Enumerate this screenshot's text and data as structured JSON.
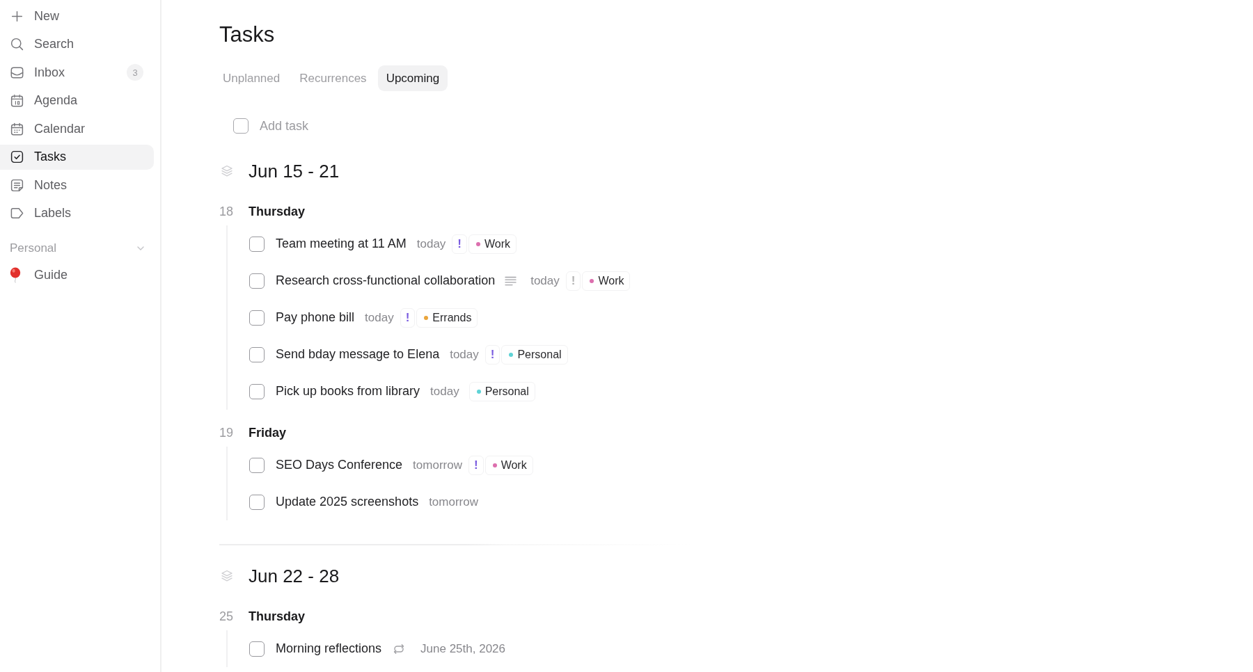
{
  "sidebar": {
    "items": [
      {
        "label": "New",
        "selected": false
      },
      {
        "label": "Search",
        "selected": false
      },
      {
        "label": "Inbox",
        "selected": false,
        "count": "3"
      },
      {
        "label": "Agenda",
        "selected": false
      },
      {
        "label": "Calendar",
        "selected": false
      },
      {
        "label": "Tasks",
        "selected": true
      },
      {
        "label": "Notes",
        "selected": false
      },
      {
        "label": "Labels",
        "selected": false
      }
    ],
    "sections": [
      {
        "title": "Personal",
        "expanded": true,
        "items": [
          {
            "label": "Guide",
            "selected": false
          }
        ]
      }
    ]
  },
  "page": {
    "title": "Tasks"
  },
  "tabs": [
    {
      "label": "Unplanned",
      "selected": false
    },
    {
      "label": "Recurrences",
      "selected": false
    },
    {
      "label": "Upcoming",
      "selected": true
    }
  ],
  "add_task": {
    "placeholder": "Add task"
  },
  "weeks": [
    {
      "title": "Jun 15 - 21",
      "days": [
        {
          "number": "18",
          "name": "Thursday",
          "tasks": [
            {
              "title": "Team meeting at 11 AM",
              "checked": false,
              "notes": false,
              "recurring": false,
              "due": "today",
              "priority": {
                "text": "!",
                "color": "#7a5ce0"
              },
              "label": {
                "name": "Work",
                "color": "#dc6fae"
              }
            },
            {
              "title": "Research cross-functional collaboration",
              "checked": false,
              "notes": true,
              "recurring": false,
              "due": "today",
              "priority": {
                "text": "!",
                "color": "#b4b4b4"
              },
              "label": {
                "name": "Work",
                "color": "#dc6fae"
              }
            },
            {
              "title": "Pay phone bill",
              "checked": false,
              "notes": false,
              "recurring": false,
              "due": "today",
              "priority": {
                "text": "!",
                "color": "#7a5ce0"
              },
              "label": {
                "name": "Errands",
                "color": "#eaa53c"
              }
            },
            {
              "title": "Send bday message to Elena",
              "checked": false,
              "notes": false,
              "recurring": false,
              "due": "today",
              "priority": {
                "text": "!",
                "color": "#7a5ce0"
              },
              "label": {
                "name": "Personal",
                "color": "#5fd3d6"
              }
            },
            {
              "title": "Pick up books from library",
              "checked": false,
              "notes": false,
              "recurring": false,
              "due": "today",
              "label": {
                "name": "Personal",
                "color": "#5fd3d6"
              }
            }
          ]
        },
        {
          "number": "19",
          "name": "Friday",
          "tasks": [
            {
              "title": "SEO Days Conference",
              "checked": false,
              "notes": false,
              "recurring": false,
              "due": "tomorrow",
              "priority": {
                "text": "!",
                "color": "#7a5ce0"
              },
              "label": {
                "name": "Work",
                "color": "#dc6fae"
              }
            },
            {
              "title": "Update 2025 screenshots",
              "checked": false,
              "notes": false,
              "recurring": false,
              "due": "tomorrow"
            }
          ]
        }
      ]
    },
    {
      "title": "Jun 22 - 28",
      "days": [
        {
          "number": "25",
          "name": "Thursday",
          "tasks": [
            {
              "title": "Morning reflections",
              "checked": false,
              "notes": false,
              "recurring": true,
              "due": "June 25th, 2026"
            }
          ]
        }
      ]
    }
  ]
}
